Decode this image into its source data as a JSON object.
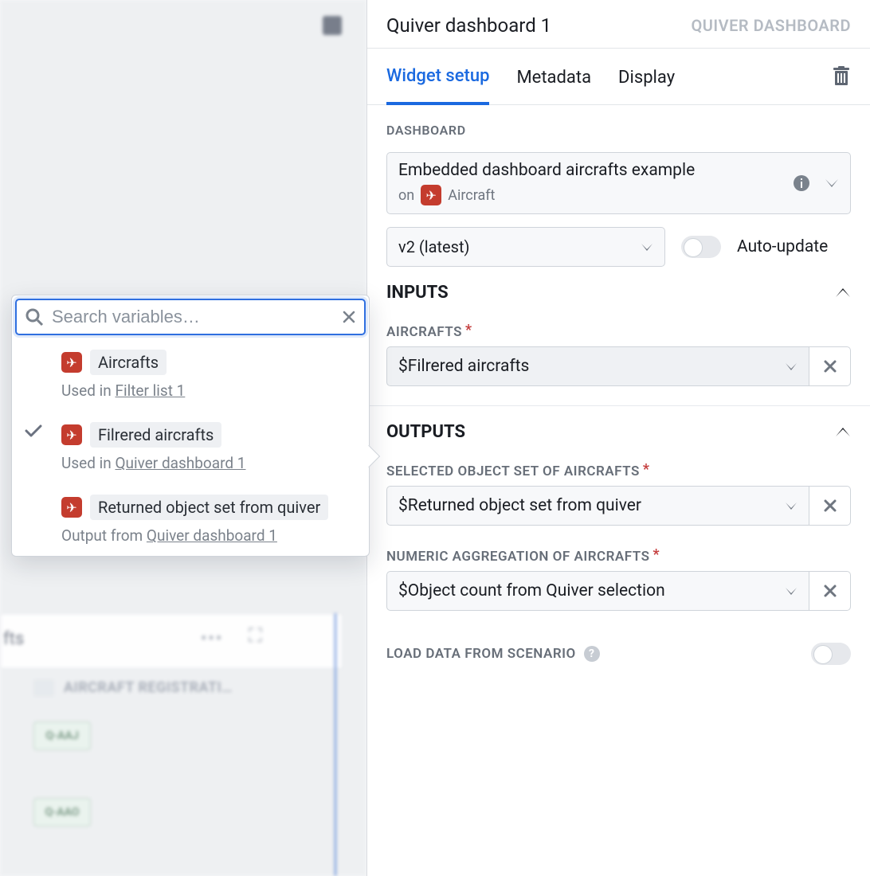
{
  "header": {
    "title": "Quiver dashboard 1",
    "type_label": "QUIVER DASHBOARD"
  },
  "tabs": {
    "widget_setup": "Widget setup",
    "metadata": "Metadata",
    "display": "Display"
  },
  "dashboard": {
    "section_label": "DASHBOARD",
    "name": "Embedded dashboard aircrafts example",
    "on_prefix": "on",
    "object_type": "Aircraft",
    "version": "v2 (latest)",
    "auto_update_label": "Auto-update"
  },
  "inputs": {
    "section_label": "INPUTS",
    "aircrafts": {
      "label": "AIRCRAFTS",
      "value": "$Filrered aircrafts"
    }
  },
  "outputs": {
    "section_label": "OUTPUTS",
    "selected_set": {
      "label": "SELECTED OBJECT SET OF AIRCRAFTS",
      "value": "$Returned object set from quiver"
    },
    "numeric_agg": {
      "label": "NUMERIC AGGREGATION OF AIRCRAFTS",
      "value": "$Object count from Quiver selection"
    }
  },
  "scenario": {
    "label": "LOAD DATA FROM SCENARIO"
  },
  "popover": {
    "search_placeholder": "Search variables…",
    "items": [
      {
        "name": "Aircrafts",
        "used_prefix": "Used in",
        "used_in": "Filter list 1",
        "selected": false
      },
      {
        "name": "Filrered aircrafts",
        "used_prefix": "Used in",
        "used_in": "Quiver dashboard 1",
        "selected": true
      },
      {
        "name": "Returned object set from quiver",
        "used_prefix": "Output from",
        "used_in": "Quiver dashboard 1",
        "selected": false
      }
    ]
  },
  "left_blur": {
    "fts": "fts",
    "col_header": "AIRCRAFT REGISTRATI…",
    "chip1": "Q-AAJ",
    "chip2": "Q-AAO"
  }
}
